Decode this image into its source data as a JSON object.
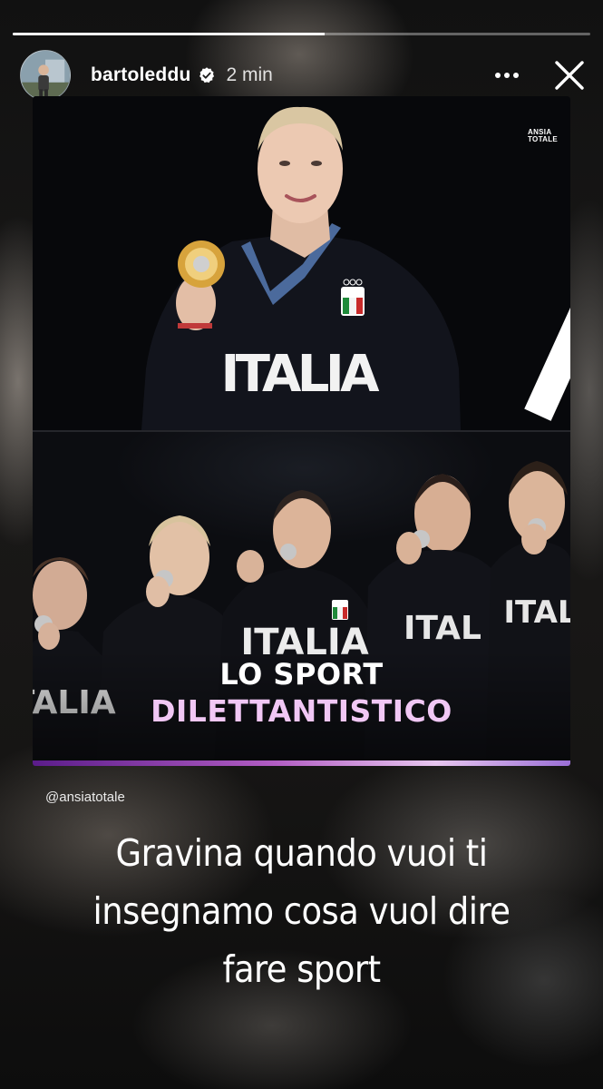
{
  "story": {
    "progress_fraction": 0.54,
    "user": {
      "username": "bartoleddu",
      "verified": true,
      "time": "2 min"
    },
    "icons": {
      "more": "more-horizontal-icon",
      "close": "close-icon",
      "verified": "verified-badge-icon"
    }
  },
  "post": {
    "brand_text": "ANSIA TOTALE",
    "top_photo_jersey": "ITALIA",
    "bottom_photo_jersey": "ITALIA",
    "headline_line1": "LO SPORT",
    "headline_line2": "DILETTANTISTICO",
    "colors": {
      "headline_accent": "#f1c7f5",
      "gradient_bar": [
        "#5b1c8a",
        "#b25dc3",
        "#e7c6ef"
      ]
    }
  },
  "mention": "@ansiatotale",
  "caption": {
    "line1": "Gravina quando vuoi ti",
    "line2": "insegnamo cosa vuol dire",
    "line3": "fare sport"
  }
}
